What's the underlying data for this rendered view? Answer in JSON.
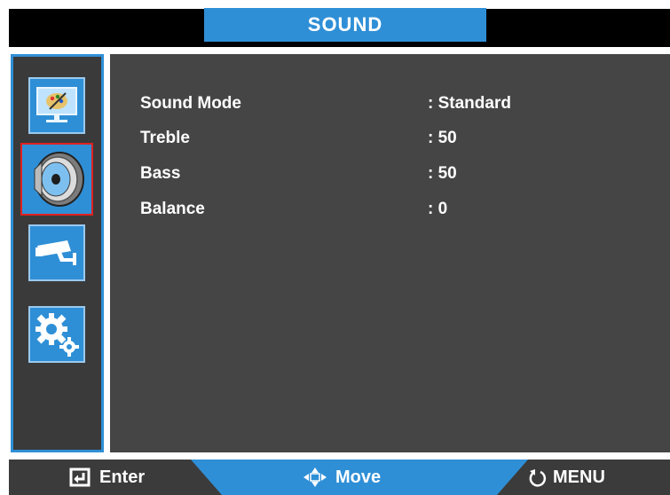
{
  "header": {
    "title": "SOUND"
  },
  "sidebar": {
    "items": [
      {
        "name": "picture",
        "icon": "picture-icon",
        "selected": false
      },
      {
        "name": "sound",
        "icon": "speaker-icon",
        "selected": true
      },
      {
        "name": "camera",
        "icon": "cctv-camera-icon",
        "selected": false
      },
      {
        "name": "setup",
        "icon": "gears-icon",
        "selected": false
      }
    ]
  },
  "menu": {
    "rows": [
      {
        "label": "Sound Mode",
        "value": ": Standard"
      },
      {
        "label": "Treble",
        "value": ": 50"
      },
      {
        "label": "Bass",
        "value": ": 50"
      },
      {
        "label": "Balance",
        "value": ": 0"
      }
    ]
  },
  "footer": {
    "enter_label": "Enter",
    "move_label": "Move",
    "menu_label": "MENU"
  },
  "colors": {
    "accent": "#2f8fd6",
    "panel": "#454545",
    "selected_border": "#e02020"
  }
}
